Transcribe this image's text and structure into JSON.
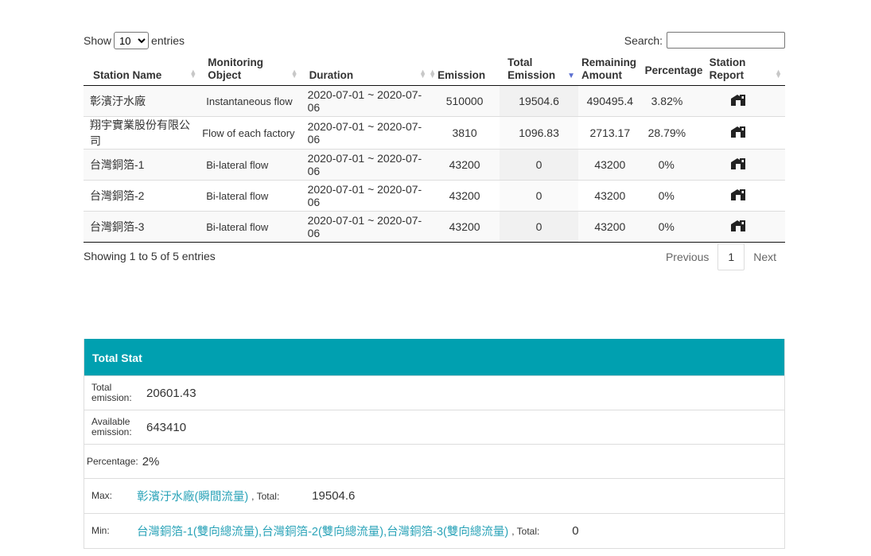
{
  "controls": {
    "show_label": "Show",
    "entries_label": "entries",
    "page_length": "10",
    "search_label": "Search:",
    "search_value": ""
  },
  "table": {
    "columns": [
      {
        "label": "Station Name",
        "sort": "both"
      },
      {
        "label": "Monitoring Object",
        "sort": "both"
      },
      {
        "label": "Duration",
        "sort": "both"
      },
      {
        "label": "Emission",
        "sort": "both"
      },
      {
        "label": "Total Emission",
        "sort": "desc"
      },
      {
        "label": "Remaining Amount",
        "sort": "none"
      },
      {
        "label": "Percentage",
        "sort": "none"
      },
      {
        "label": "Station Report",
        "sort": "both"
      }
    ],
    "rows": [
      {
        "station": "彰濱汙水廠",
        "object": "Instantaneous flow",
        "duration": "2020-07-01 ~ 2020-07-06",
        "emission": "510000",
        "total": "19504.6",
        "remaining": "490495.4",
        "percentage": "3.82%",
        "report_icon": "house-report-icon"
      },
      {
        "station": "翔宇實業股份有限公司",
        "object": "Flow of each factory",
        "duration": "2020-07-01 ~ 2020-07-06",
        "emission": "3810",
        "total": "1096.83",
        "remaining": "2713.17",
        "percentage": "28.79%",
        "report_icon": "house-report-icon"
      },
      {
        "station": "台灣銅箔-1",
        "object": "Bi-lateral flow",
        "duration": "2020-07-01 ~ 2020-07-06",
        "emission": "43200",
        "total": "0",
        "remaining": "43200",
        "percentage": "0%",
        "report_icon": "house-report-icon"
      },
      {
        "station": "台灣銅箔-2",
        "object": "Bi-lateral flow",
        "duration": "2020-07-01 ~ 2020-07-06",
        "emission": "43200",
        "total": "0",
        "remaining": "43200",
        "percentage": "0%",
        "report_icon": "house-report-icon"
      },
      {
        "station": "台灣銅箔-3",
        "object": "Bi-lateral flow",
        "duration": "2020-07-01 ~ 2020-07-06",
        "emission": "43200",
        "total": "0",
        "remaining": "43200",
        "percentage": "0%",
        "report_icon": "house-report-icon"
      }
    ]
  },
  "footer": {
    "info": "Showing 1 to 5 of 5 entries",
    "previous": "Previous",
    "current_page": "1",
    "next": "Next"
  },
  "stat": {
    "title": "Total Stat",
    "header_color": "#00a0b0",
    "link_color": "#2aa3b8",
    "total_emission_label": "Total emission:",
    "total_emission_value": "20601.43",
    "available_emission_label": "Available emission:",
    "available_emission_value": "643410",
    "percentage_label": "Percentage:",
    "percentage_value": "2%",
    "max_label": "Max:",
    "max_link": "彰濱汙水廠(瞬間流量)",
    "max_total_label": ", Total:",
    "max_total_value": "19504.6",
    "min_label": "Min:",
    "min_link": "台灣銅箔-1(雙向總流量),台灣銅箔-2(雙向總流量),台灣銅箔-3(雙向總流量)",
    "min_total_label": ", Total:",
    "min_total_value": "0"
  }
}
